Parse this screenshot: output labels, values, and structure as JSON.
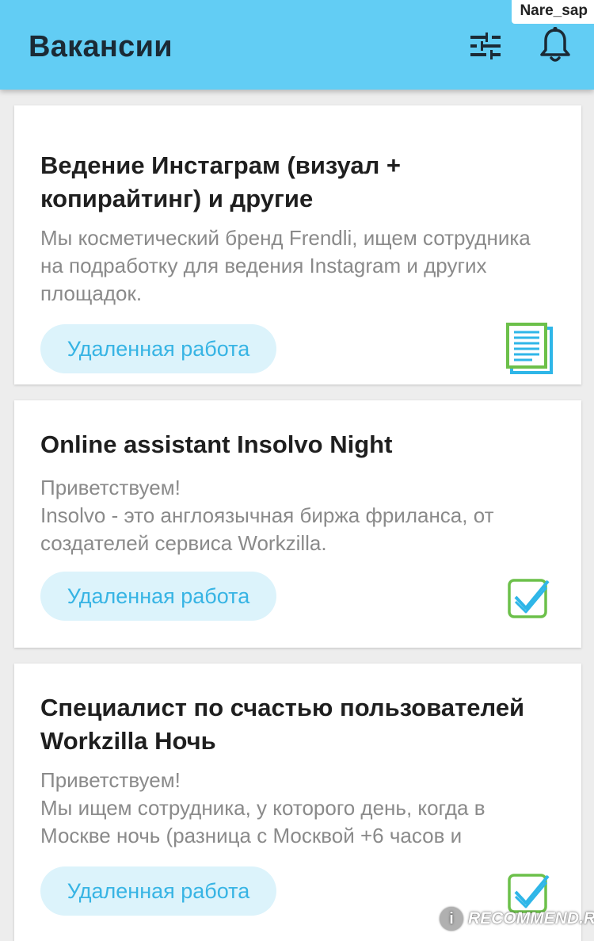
{
  "header": {
    "title": "Вакансии",
    "filter_icon": "filter-sliders-icon",
    "bell_icon": "bell-icon"
  },
  "watermark": {
    "username": "Nare_sap",
    "brand": "RECOMMEND.RU",
    "brand_badge": "i"
  },
  "colors": {
    "appbar": "#62cdf4",
    "tag_bg": "#dcf3fb",
    "tag_text": "#37b4e4",
    "icon_green": "#6cc04a",
    "icon_blue": "#2fb6e8"
  },
  "vacancies": [
    {
      "title": "Ведение Инстаграм (визуал + копирайтинг) и другие",
      "description": "Мы косметический бренд Frendli, ищем сотрудника на подработку для ведения Instagram и других площадок.",
      "tag": "Удаленная работа",
      "status_icon": "document-icon"
    },
    {
      "title": "Online assistant Insolvo Night",
      "description": "Приветствуем!\nInsolvo - это англоязычная биржа фриланса, от создателей сервиса Workzilla.",
      "tag": "Удаленная работа",
      "status_icon": "checkmark-icon"
    },
    {
      "title": "Специалист по счастью пользователей Workzilla Ночь",
      "description": "Приветствуем!\nМы ищем сотрудника, у которого день, когда в Москве ночь (разница с Москвой +6 часов и",
      "tag": "Удаленная работа",
      "status_icon": "checkmark-icon"
    }
  ]
}
